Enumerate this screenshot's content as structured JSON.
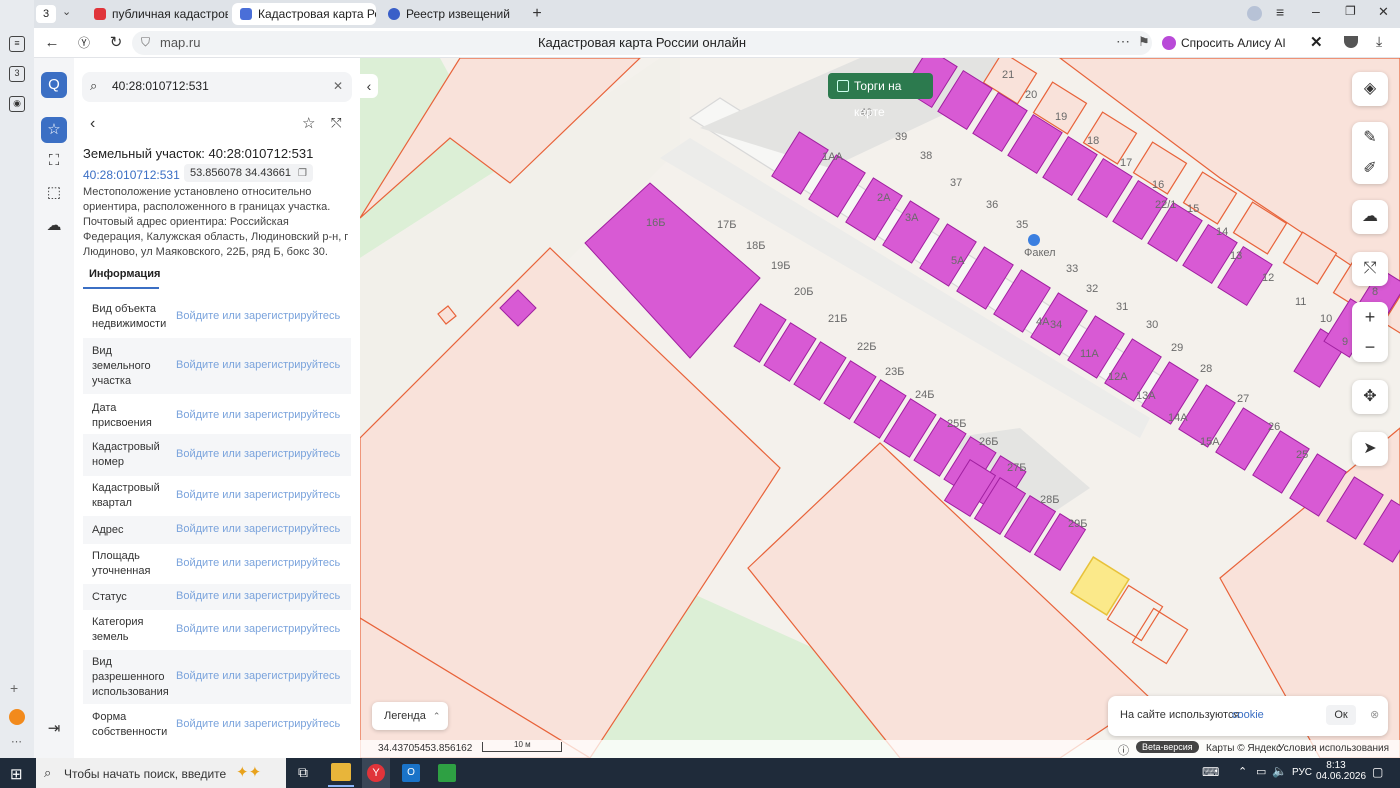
{
  "browser": {
    "tab_count": "3",
    "tabs": [
      {
        "label": "публичная кадастровая к",
        "color": "#e0343a"
      },
      {
        "label": "Кадастровая карта Рос",
        "color": "#4a6fd8"
      },
      {
        "label": "Реестр извещений",
        "color": "#3a5fc8"
      }
    ],
    "url": "map.ru",
    "page_title": "Кадастровая карта России онлайн",
    "alice": "Спросить Алису AI"
  },
  "sidebar": {
    "search_value": "40:28:010712:531",
    "parcel_title": "Земельный участок: 40:28:010712:531",
    "cadastral_link": "40:28:010712:531",
    "coords": "53.856078 34.43661",
    "description": "Местоположение установлено относительно ориентира, расположенного в границах участка. Почтовый адрес ориентира: Российская Федерация, Калужская область, Людиновский р-н, г Людиново, ул Маяковского, 22Б, ряд Б, бокс 30.",
    "tab_info": "Информация",
    "login_text": "Войдите или зарегистрируйтесь",
    "rows": [
      "Вид объекта недвижимости",
      "Вид земельного участка",
      "Дата присвоения",
      "Кадастровый номер",
      "Кадастровый квартал",
      "Адрес",
      "Площадь уточненная",
      "Статус",
      "Категория земель",
      "Вид разрешенного использования",
      "Форма собственности"
    ]
  },
  "map": {
    "torgi": "Торги на карте",
    "legend": "Легенда",
    "cookie_text": "На сайте используются",
    "cookie_link": "cookie",
    "cookie_ok": "Ок",
    "coords_x": "34.437054",
    "coords_y": "53.856162",
    "scale": "10 м",
    "beta": "Beta-версия",
    "maps_credit": "Карты © Яндекс",
    "terms": "Условия использования",
    "poi": "Факел",
    "labels": [
      "21",
      "20",
      "19",
      "18",
      "17",
      "16",
      "22/1",
      "15",
      "14",
      "13",
      "12",
      "11",
      "10",
      "9",
      "8",
      "40",
      "39",
      "38",
      "37",
      "36",
      "35",
      "34",
      "33",
      "32",
      "31",
      "30",
      "29",
      "28",
      "27",
      "26",
      "25",
      "1АА",
      "2А",
      "3А",
      "4А",
      "5А",
      "11А",
      "12А",
      "13А",
      "14А",
      "15А",
      "16Б",
      "17Б",
      "18Б",
      "19Б",
      "20Б",
      "21Б",
      "22Б",
      "23Б",
      "24Б",
      "25Б",
      "26Б",
      "27Б",
      "28Б",
      "29Б"
    ]
  },
  "taskbar": {
    "search_placeholder": "Чтобы начать поиск, введите",
    "lang": "РУС",
    "time": "8:13",
    "date": "04.06.2026"
  },
  "colors": {
    "parcel_fill": "#f9e2da",
    "parcel_stroke": "#e8633a",
    "garage_fill": "#d85ad4",
    "garage_stroke": "#a020a0",
    "selected_fill": "#fbe98a",
    "green_area": "#dcefd6"
  }
}
